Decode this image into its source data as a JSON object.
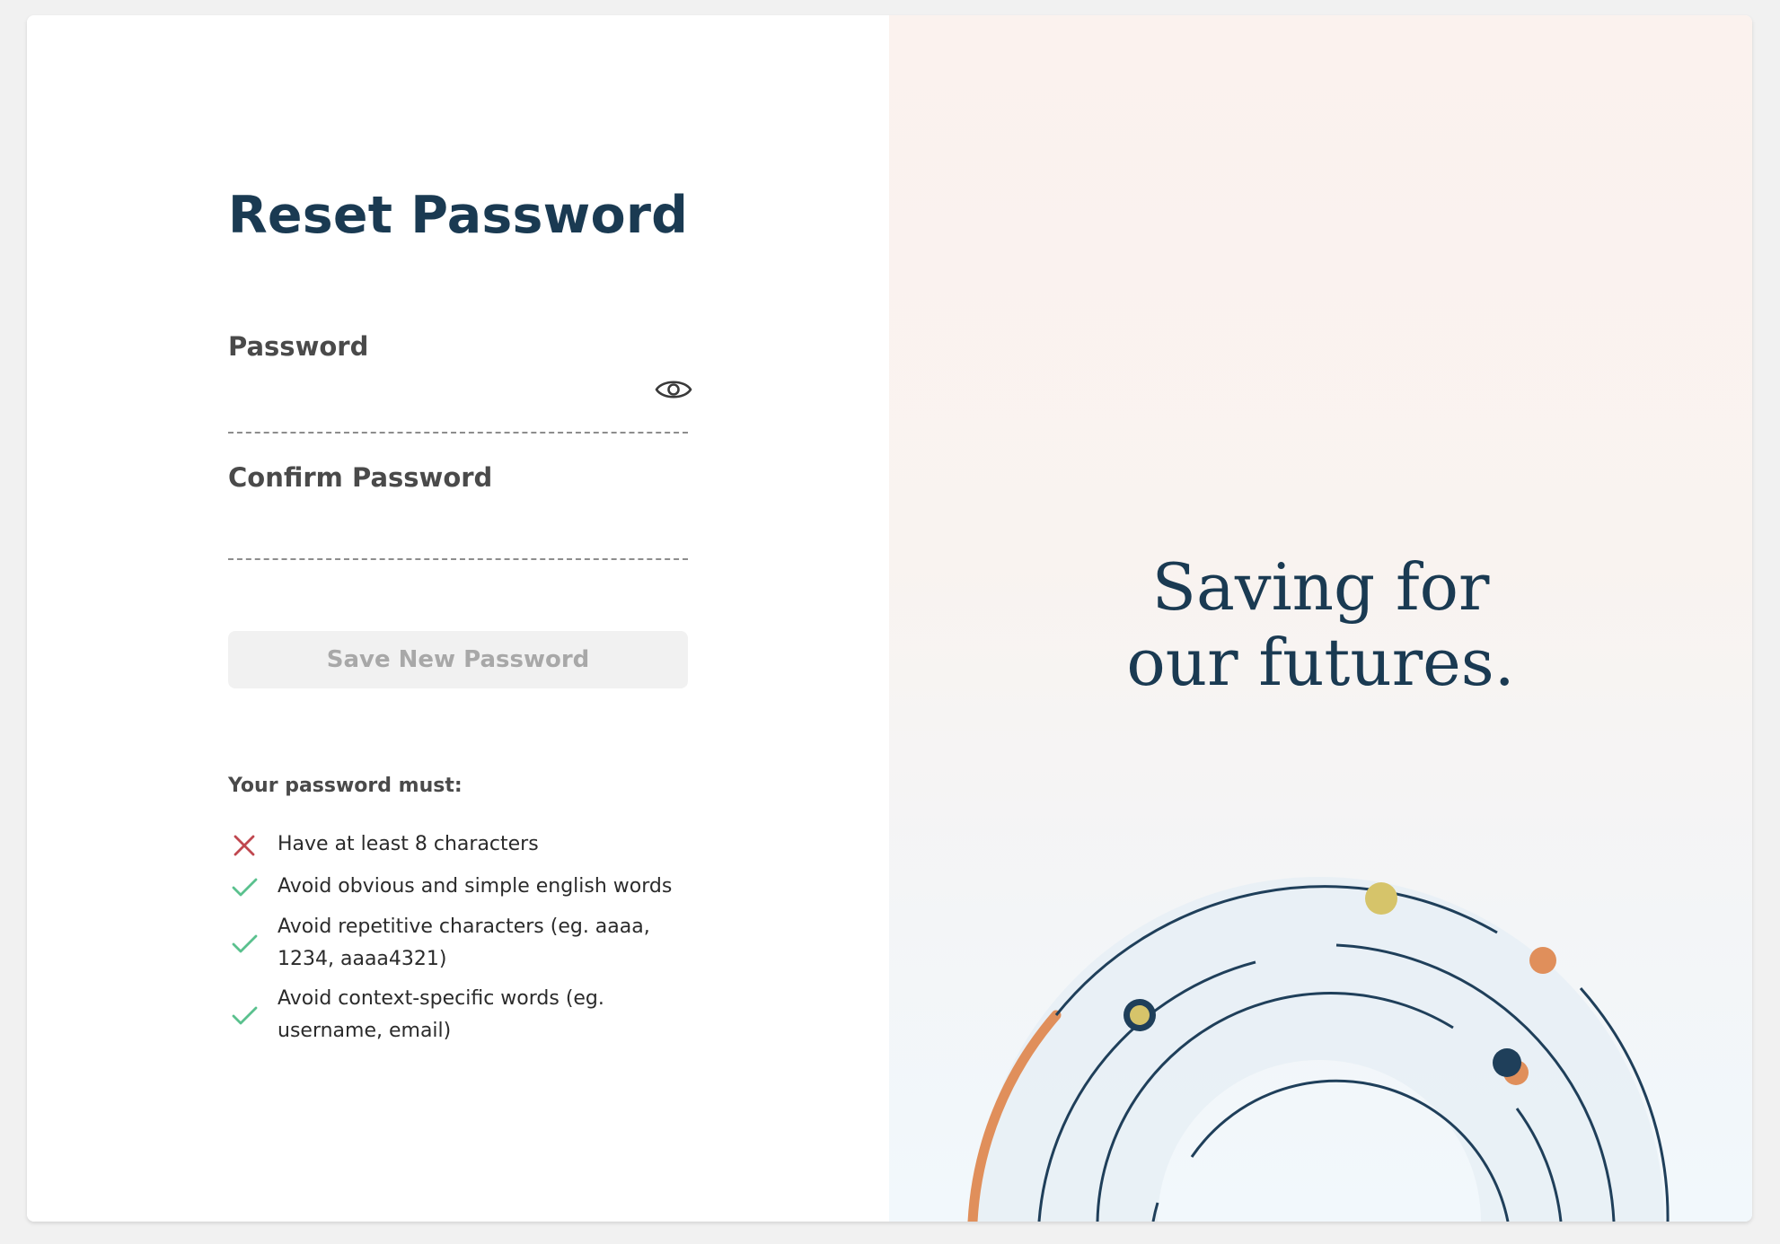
{
  "reset_form": {
    "title": "Reset Password",
    "password_label": "Password",
    "password_value": "",
    "confirm_label": "Confirm Password",
    "confirm_value": "",
    "save_button_label": "Save New Password",
    "show_password_icon": "eye-icon"
  },
  "requirements": {
    "title": "Your password must:",
    "items": [
      {
        "text": "Have at least 8 characters",
        "status": "failed",
        "icon": "x-icon"
      },
      {
        "text": "Avoid obvious and simple english words",
        "status": "passed",
        "icon": "check-icon"
      },
      {
        "text": "Avoid repetitive characters (eg. aaaa, 1234, aaaa4321)",
        "status": "passed",
        "icon": "check-icon"
      },
      {
        "text": "Avoid context-specific words (eg. username, email)",
        "status": "passed",
        "icon": "check-icon"
      }
    ]
  },
  "hero": {
    "tagline_line1": "Saving for",
    "tagline_line2": "our futures."
  },
  "colors": {
    "brand_navy": "#1a3a52",
    "error_red": "#c0474f",
    "success_green": "#5ac18e",
    "accent_orange": "#e08f5b",
    "accent_yellow": "#d6c46a",
    "hero_bg_top": "#fbf2ee",
    "hero_bg_bottom": "#f2f8fc",
    "disabled_button_bg": "#f1f1f1",
    "disabled_button_text": "#a8a8a8"
  }
}
